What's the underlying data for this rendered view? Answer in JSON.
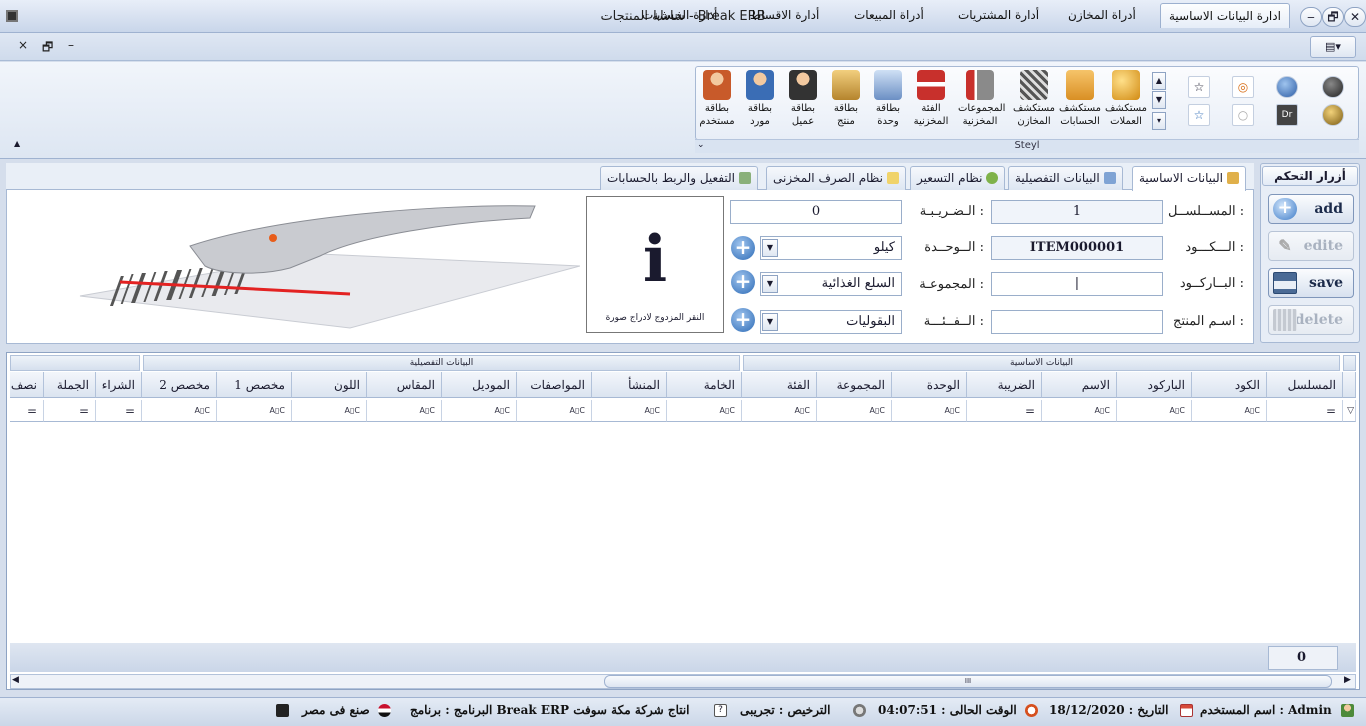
{
  "window": {
    "title": "شاشة المنتجات - Break ERB",
    "minimize": "‒",
    "restore": "🗗",
    "close": "✕",
    "dropdown": "▾"
  },
  "mdi": {
    "close": "×",
    "restore": "🗗",
    "minimize": "–"
  },
  "menu": {
    "tabs": [
      "ادارة البيانات الاساسية",
      "أدراة المخازن",
      "أدارة المشتريات",
      "أدراة المبيعات",
      "أدارة الاقساط",
      "أدارة الحسابات"
    ]
  },
  "ribbon": {
    "items": [
      {
        "label": "مستكشف العملات",
        "icon": "coins-icon",
        "color": "#e2a22a"
      },
      {
        "label": "مستكشف الحسابات",
        "icon": "tree-icon",
        "color": "#e8a53c"
      },
      {
        "label": "مستكشف المخازن",
        "icon": "warehouse-icon",
        "color": "#7a7a7a"
      },
      {
        "label": "المجموعات المخزنية",
        "icon": "hierarchy-icon",
        "color": "#c8302c"
      },
      {
        "label": "الفئة المخزنية",
        "icon": "org-chart-icon",
        "color": "#c8302c"
      },
      {
        "label": "بطاقة وحدة",
        "icon": "scale-icon",
        "color": "#6b8fc4"
      },
      {
        "label": "بطاقة منتج",
        "icon": "box-icon",
        "color": "#d9a54a"
      },
      {
        "label": "بطاقة عميل",
        "icon": "customer-icon",
        "color": "#a33b2a"
      },
      {
        "label": "بطاقة مورد",
        "icon": "supplier-icon",
        "color": "#3a6db5"
      },
      {
        "label": "بطاقة مستخدم",
        "icon": "user-key-icon",
        "color": "#c85a2a"
      }
    ],
    "gallery": [
      "☆",
      "◎",
      "●",
      "●",
      "☆",
      "○",
      "Dr",
      "●"
    ],
    "group_label": "Steyl",
    "group_launcher": "⌄",
    "collapse": "▲"
  },
  "control": {
    "title": "أزرار التحكم",
    "add": "add",
    "edit": "edite",
    "save": "save",
    "delete": "delete"
  },
  "formtabs": [
    "البيانات الاساسية",
    "البيانات التفصيلية",
    "نظام التسعير",
    "نظام الصرف المخزنى",
    "التفعيل والربط بالحسابات"
  ],
  "form": {
    "serial_label": "المســلســل :",
    "serial_value": "1",
    "code_label": "الـــكـــود :",
    "code_value": "ITEM000001",
    "barcode_label": "البــاركــود :",
    "barcode_value": "|",
    "name_label": "اسـم المنتج :",
    "name_value": "",
    "tax_label": "الـضـريـبـة :",
    "tax_value": "0",
    "unit_label": "الــوحــدة :",
    "unit_value": "كيلو",
    "group_label": "المجموعـة :",
    "group_value": "السلع الغذائية",
    "category_label": "الــفــئـــة :",
    "category_value": "البقوليات",
    "image_glyph": "i",
    "image_hint": "النقر المزدوج لادراج صورة"
  },
  "grid": {
    "band_basic": "البيانات الاساسية",
    "band_detail": "البيانات التفصيلية",
    "columns": [
      "المسلسل",
      "الكود",
      "الباركود",
      "الاسم",
      "الضريبة",
      "الوحدة",
      "المجموعة",
      "الفئة",
      "الخامة",
      "المنشأ",
      "المواصفات",
      "الموديل",
      "المقاس",
      "اللون",
      "مخصص 1",
      "مخصص 2",
      "الشراء",
      "الجملة",
      "نصف"
    ],
    "filter_eq": "=",
    "filter_abc": "A▯C",
    "filter_icon": "▽",
    "footer_count": "0",
    "scroll_left": "◀",
    "scroll_right": "▶",
    "scroll_grip": "III"
  },
  "status": {
    "user": "اسم المستخدم : Admin",
    "date": "التاريخ : 18/12/2020",
    "time": "الوقت الحالى : 04:07:51",
    "license": "الترخيص : تجريبى",
    "program": "البرنامج : برنامج Break ERP  انتاج شركة مكة سوفت",
    "made_in": "صنع فى مصر"
  }
}
